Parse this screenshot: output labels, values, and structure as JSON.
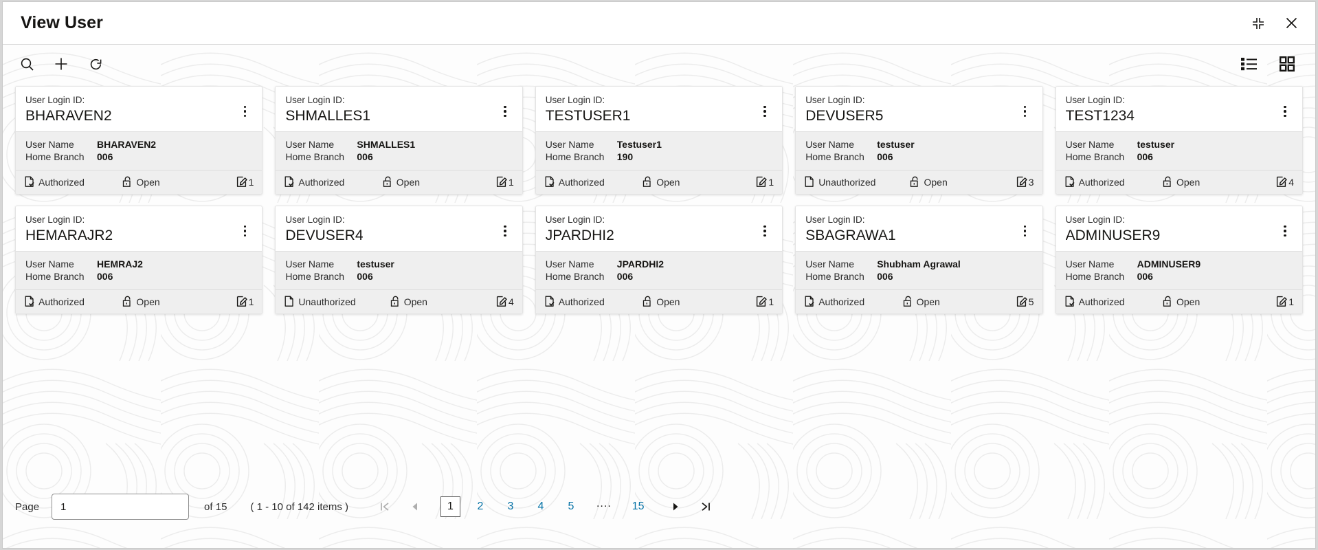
{
  "window": {
    "title": "View User",
    "restore_icon": "collapse-icon",
    "close_icon": "close-icon"
  },
  "toolbar": {
    "search_icon": "search-icon",
    "add_icon": "plus-icon",
    "refresh_icon": "refresh-icon",
    "list_view_icon": "list-view-icon",
    "grid_view_icon": "grid-view-icon"
  },
  "card_labels": {
    "login_id": "User Login ID:",
    "user_name": "User Name",
    "home_branch": "Home Branch",
    "menu_icon": "kebab-menu-icon",
    "auth_icon": "authorized-document-icon",
    "unauth_icon": "unauthorized-document-icon",
    "lock_icon": "open-lock-icon",
    "mod_icon": "edit-document-icon"
  },
  "cards": [
    {
      "login_id": "BHARAVEN2",
      "user_name": "BHARAVEN2",
      "home_branch": "006",
      "auth_status": "Authorized",
      "authorized": true,
      "lock_status": "Open",
      "mod_number": "1"
    },
    {
      "login_id": "SHMALLES1",
      "user_name": "SHMALLES1",
      "home_branch": "006",
      "auth_status": "Authorized",
      "authorized": true,
      "lock_status": "Open",
      "mod_number": "1"
    },
    {
      "login_id": "TESTUSER1",
      "user_name": "Testuser1",
      "home_branch": "190",
      "auth_status": "Authorized",
      "authorized": true,
      "lock_status": "Open",
      "mod_number": "1"
    },
    {
      "login_id": "DEVUSER5",
      "user_name": "testuser",
      "home_branch": "006",
      "auth_status": "Unauthorized",
      "authorized": false,
      "lock_status": "Open",
      "mod_number": "3"
    },
    {
      "login_id": "TEST1234",
      "user_name": "testuser",
      "home_branch": "006",
      "auth_status": "Authorized",
      "authorized": true,
      "lock_status": "Open",
      "mod_number": "4"
    },
    {
      "login_id": "HEMARAJR2",
      "user_name": "HEMRAJ2",
      "home_branch": "006",
      "auth_status": "Authorized",
      "authorized": true,
      "lock_status": "Open",
      "mod_number": "1"
    },
    {
      "login_id": "DEVUSER4",
      "user_name": "testuser",
      "home_branch": "006",
      "auth_status": "Unauthorized",
      "authorized": false,
      "lock_status": "Open",
      "mod_number": "4"
    },
    {
      "login_id": "JPARDHI2",
      "user_name": "JPARDHI2",
      "home_branch": "006",
      "auth_status": "Authorized",
      "authorized": true,
      "lock_status": "Open",
      "mod_number": "1"
    },
    {
      "login_id": "SBAGRAWA1",
      "user_name": "Shubham Agrawal",
      "home_branch": "006",
      "auth_status": "Authorized",
      "authorized": true,
      "lock_status": "Open",
      "mod_number": "5"
    },
    {
      "login_id": "ADMINUSER9",
      "user_name": "ADMINUSER9",
      "home_branch": "006",
      "auth_status": "Authorized",
      "authorized": true,
      "lock_status": "Open",
      "mod_number": "1"
    }
  ],
  "pagination": {
    "page_label": "Page",
    "page_value": "1",
    "of_label": "of 15",
    "range_label": "( 1 - 10 of 142 items )",
    "first_icon": "first-page-icon",
    "prev_icon": "previous-page-icon",
    "next_icon": "next-page-icon",
    "last_icon": "last-page-icon",
    "pages": [
      "1",
      "2",
      "3",
      "4",
      "5",
      "....",
      "15"
    ],
    "current_page": "1",
    "link_color": "#0572a6"
  }
}
